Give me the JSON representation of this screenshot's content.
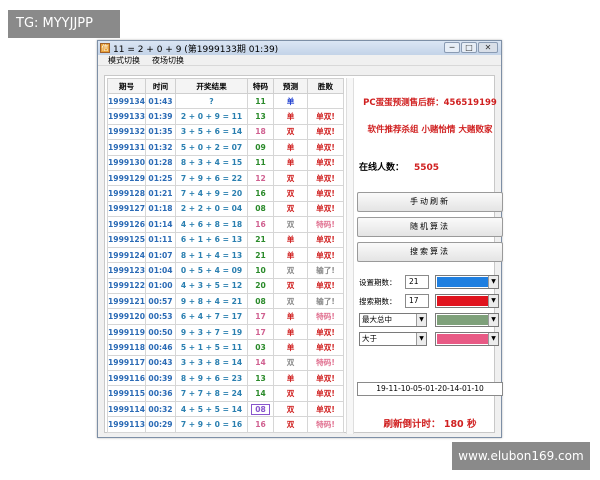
{
  "watermarks": {
    "top_left": "TG: MYYJJPP",
    "bottom_right": "www.elubon169.com"
  },
  "window": {
    "title": "11 = 2 + 0 + 9 (第1999133期 01:39)",
    "app_icon": "信",
    "controls": {
      "minimize": "─",
      "restore": "□",
      "close": "✕"
    }
  },
  "menu": {
    "items": [
      "模式切换",
      "夜场切换"
    ]
  },
  "table": {
    "headers": [
      "期号",
      "时间",
      "开奖结果",
      "特码",
      "预测",
      "胜败"
    ],
    "rows": [
      {
        "issue": "1999134",
        "time": "01:43",
        "result": "?",
        "code": "11",
        "code_style": "green",
        "pred": "单",
        "pred_style": "blue",
        "outcome": "",
        "out_style": "red"
      },
      {
        "issue": "1999133",
        "time": "01:39",
        "result": "2 + 0 + 9 = 11",
        "code": "13",
        "code_style": "green",
        "pred": "单",
        "pred_style": "red",
        "outcome": "单双!",
        "out_style": "red"
      },
      {
        "issue": "1999132",
        "time": "01:35",
        "result": "3 + 5 + 6 = 14",
        "code": "18",
        "code_style": "pink",
        "pred": "双",
        "pred_style": "red",
        "outcome": "单双!",
        "out_style": "red"
      },
      {
        "issue": "1999131",
        "time": "01:32",
        "result": "5 + 0 + 2 = 07",
        "code": "09",
        "code_style": "green",
        "pred": "单",
        "pred_style": "red",
        "outcome": "单双!",
        "out_style": "red"
      },
      {
        "issue": "1999130",
        "time": "01:28",
        "result": "8 + 3 + 4 = 15",
        "code": "11",
        "code_style": "green",
        "pred": "单",
        "pred_style": "red",
        "outcome": "单双!",
        "out_style": "red"
      },
      {
        "issue": "1999129",
        "time": "01:25",
        "result": "7 + 9 + 6 = 22",
        "code": "12",
        "code_style": "pink",
        "pred": "双",
        "pred_style": "red",
        "outcome": "单双!",
        "out_style": "red"
      },
      {
        "issue": "1999128",
        "time": "01:21",
        "result": "7 + 4 + 9 = 20",
        "code": "16",
        "code_style": "green",
        "pred": "双",
        "pred_style": "red",
        "outcome": "单双!",
        "out_style": "red"
      },
      {
        "issue": "1999127",
        "time": "01:18",
        "result": "2 + 2 + 0 = 04",
        "code": "08",
        "code_style": "green",
        "pred": "双",
        "pred_style": "red",
        "outcome": "单双!",
        "out_style": "red"
      },
      {
        "issue": "1999126",
        "time": "01:14",
        "result": "4 + 6 + 8 = 18",
        "code": "16",
        "code_style": "pink",
        "pred": "双",
        "pred_style": "gray",
        "outcome": "特码!",
        "out_style": "pink"
      },
      {
        "issue": "1999125",
        "time": "01:11",
        "result": "6 + 1 + 6 = 13",
        "code": "21",
        "code_style": "green",
        "pred": "单",
        "pred_style": "red",
        "outcome": "单双!",
        "out_style": "red"
      },
      {
        "issue": "1999124",
        "time": "01:07",
        "result": "8 + 1 + 4 = 13",
        "code": "21",
        "code_style": "green",
        "pred": "单",
        "pred_style": "red",
        "outcome": "单双!",
        "out_style": "red"
      },
      {
        "issue": "1999123",
        "time": "01:04",
        "result": "0 + 5 + 4 = 09",
        "code": "10",
        "code_style": "green",
        "pred": "双",
        "pred_style": "gray",
        "outcome": "输了!",
        "out_style": "gray"
      },
      {
        "issue": "1999122",
        "time": "01:00",
        "result": "4 + 3 + 5 = 12",
        "code": "20",
        "code_style": "green",
        "pred": "双",
        "pred_style": "red",
        "outcome": "单双!",
        "out_style": "red"
      },
      {
        "issue": "1999121",
        "time": "00:57",
        "result": "9 + 8 + 4 = 21",
        "code": "08",
        "code_style": "green",
        "pred": "双",
        "pred_style": "gray",
        "outcome": "输了!",
        "out_style": "gray"
      },
      {
        "issue": "1999120",
        "time": "00:53",
        "result": "6 + 4 + 7 = 17",
        "code": "17",
        "code_style": "pink",
        "pred": "单",
        "pred_style": "red",
        "outcome": "特码!",
        "out_style": "pink"
      },
      {
        "issue": "1999119",
        "time": "00:50",
        "result": "9 + 3 + 7 = 19",
        "code": "17",
        "code_style": "pink",
        "pred": "单",
        "pred_style": "red",
        "outcome": "单双!",
        "out_style": "red"
      },
      {
        "issue": "1999118",
        "time": "00:46",
        "result": "5 + 1 + 5 = 11",
        "code": "03",
        "code_style": "green",
        "pred": "单",
        "pred_style": "red",
        "outcome": "单双!",
        "out_style": "red"
      },
      {
        "issue": "1999117",
        "time": "00:43",
        "result": "3 + 3 + 8 = 14",
        "code": "14",
        "code_style": "pink",
        "pred": "双",
        "pred_style": "gray",
        "outcome": "特码!",
        "out_style": "pink"
      },
      {
        "issue": "1999116",
        "time": "00:39",
        "result": "8 + 9 + 6 = 23",
        "code": "13",
        "code_style": "green",
        "pred": "单",
        "pred_style": "red",
        "outcome": "单双!",
        "out_style": "red"
      },
      {
        "issue": "1999115",
        "time": "00:36",
        "result": "7 + 7 + 8 = 24",
        "code": "14",
        "code_style": "green",
        "pred": "双",
        "pred_style": "red",
        "outcome": "单双!",
        "out_style": "red"
      },
      {
        "issue": "1999114",
        "time": "00:32",
        "result": "4 + 5 + 5 = 14",
        "code": "08",
        "code_style": "selected",
        "pred": "双",
        "pred_style": "red",
        "outcome": "单双!",
        "out_style": "red"
      },
      {
        "issue": "1999113",
        "time": "00:29",
        "result": "7 + 9 + 0 = 16",
        "code": "16",
        "code_style": "pink",
        "pred": "双",
        "pred_style": "red",
        "outcome": "特码!",
        "out_style": "pink"
      }
    ]
  },
  "panel": {
    "qq_group": "PC蛋蛋预测售后群：456519199",
    "slogan": "软件推荐杀组  小赌怡情  大赌败家",
    "online_label": "在线人数：",
    "online_count": "5505",
    "buttons": {
      "manual_refresh": "手动刷新",
      "random_algo": "随机算法",
      "search_algo": "搜索算法"
    },
    "set_periods_label": "设置期数：",
    "set_periods_value": "21",
    "search_periods_label": "搜索期数：",
    "search_periods_value": "17",
    "mode_select": "最大总中",
    "compare_select": "大于",
    "colors": {
      "c1": "#1f7fe0",
      "c2": "#e0141e",
      "c3": "#7ea07a",
      "c4": "#e85a85"
    },
    "sequence": "19-11-10-05-01-20-14-01-10",
    "countdown_label": "刷新倒计时：",
    "countdown_value": "180",
    "countdown_unit": "秒"
  }
}
